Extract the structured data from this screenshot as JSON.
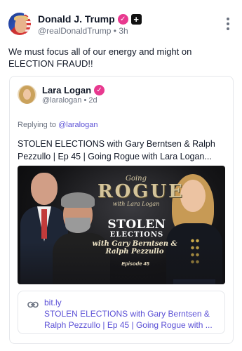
{
  "post": {
    "author_name": "Donald J. Trump",
    "author_handle": "@realDonaldTrump",
    "time": "3h",
    "separator": "•",
    "verified_mark": "✓",
    "plus_badge": "+",
    "text_line1": "We must focus all of our energy and might on",
    "text_line2": "ELECTION FRAUD!!",
    "more_icon": "more-vertical-icon"
  },
  "quote": {
    "author_name": "Lara Logan",
    "author_handle": "@laralogan",
    "time": "2d",
    "separator": "•",
    "verified_mark": "✓",
    "replying_prefix": "Replying to ",
    "replying_handle": "@laralogan",
    "text_line1": "STOLEN ELECTIONS with Gary Berntsen & Ralph",
    "text_line2": "Pezzullo | Ep 45 | Going Rogue with Lara Logan..."
  },
  "media": {
    "going": "Going",
    "rogue": "ROGUE",
    "with_host": "with Lara Logan",
    "stolen": "STOLEN",
    "elections": "ELECTIONS",
    "guests_line1": "with Gary Berntsen &",
    "guests_line2": "Ralph Pezzullo",
    "episode": "Episode 45"
  },
  "link": {
    "domain": "bit.ly",
    "title_line1": "STOLEN ELECTIONS with Gary Berntsen &",
    "title_line2": "Ralph Pezzullo | Ep 45 | Going Rogue with ...",
    "icon": "link-icon"
  },
  "colors": {
    "verified": "#e8398f",
    "link": "#5b50d6",
    "muted": "#6b7280",
    "text": "#111827",
    "border": "#e5e7eb"
  }
}
